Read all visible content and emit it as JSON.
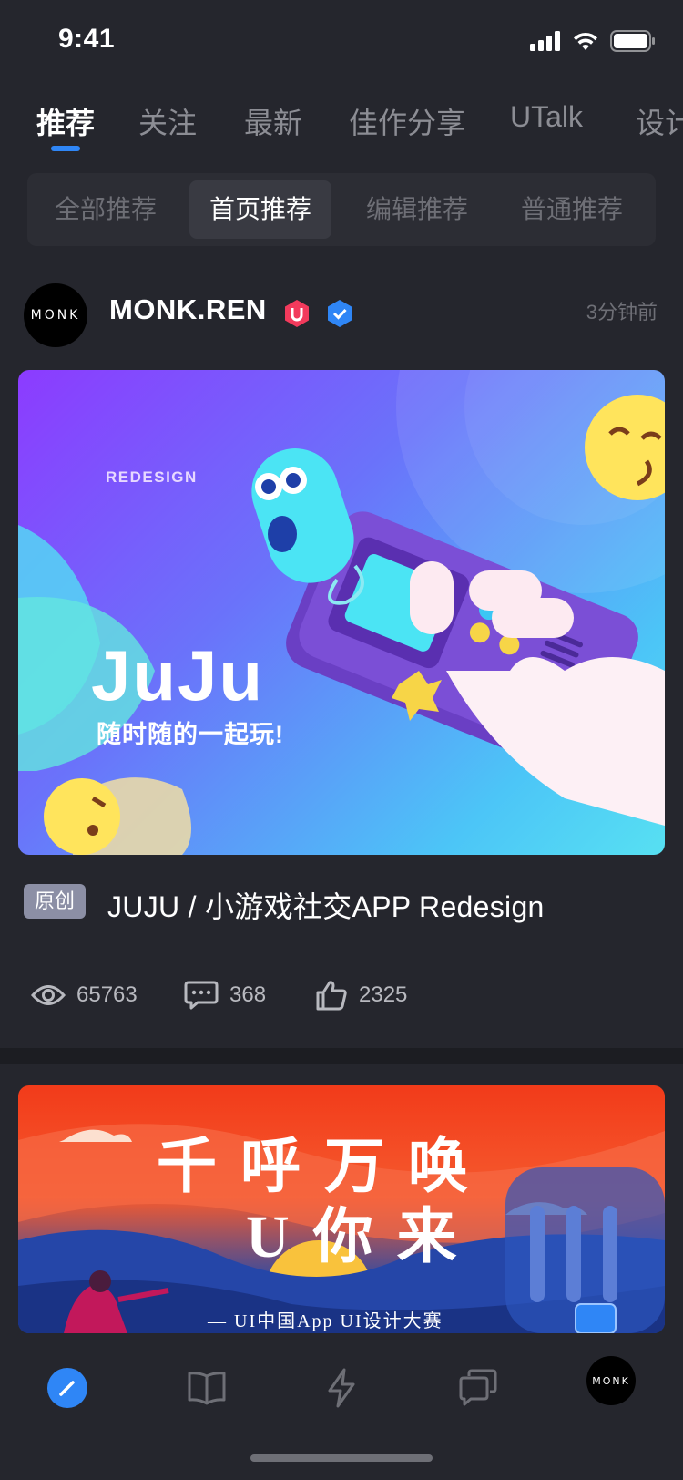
{
  "status_bar": {
    "time": "9:41"
  },
  "tabs": [
    {
      "label": "推荐"
    },
    {
      "label": "关注"
    },
    {
      "label": "最新"
    },
    {
      "label": "佳作分享"
    },
    {
      "label": "UTalk"
    },
    {
      "label": "设计"
    }
  ],
  "segments": [
    {
      "label": "全部推荐"
    },
    {
      "label": "首页推荐"
    },
    {
      "label": "编辑推荐"
    },
    {
      "label": "普通推荐"
    }
  ],
  "post": {
    "avatar_text": "MONK",
    "author": "MONK.REN",
    "time": "3分钟前",
    "image_text": {
      "tag": "REDESIGN",
      "title": "JuJu",
      "subtitle": "随时随的一起玩!"
    },
    "badge": "原创",
    "title": "JUJU / 小游戏社交APP Redesign",
    "stats": {
      "views": "65763",
      "comments": "368",
      "likes": "2325"
    }
  },
  "post2": {
    "poster_line1": "千呼万唤",
    "poster_line2": "U你来",
    "poster_sub": "— UI中国App UI设计大赛"
  },
  "bottom_nav": {
    "avatar_text": "MONK"
  },
  "colors": {
    "accent": "#2F86F6",
    "background": "#25262D",
    "badge": "#8C8FA5"
  }
}
